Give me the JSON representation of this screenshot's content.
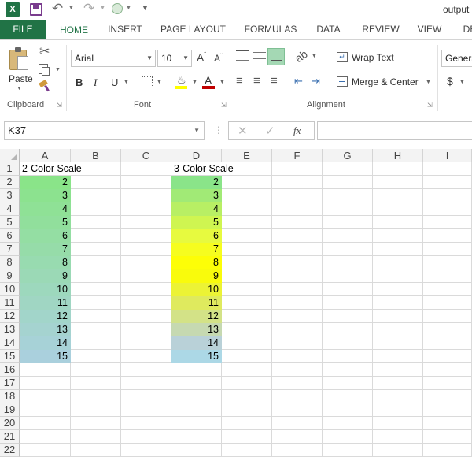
{
  "window": {
    "title": "output"
  },
  "qat": {
    "excel_icon": "excel-icon",
    "save_icon": "save-icon",
    "undo_icon": "undo-icon",
    "redo_icon": "redo-icon",
    "touch_icon": "touch-mode-icon",
    "customize_icon": "customize-icon"
  },
  "tabs": [
    {
      "label": "FILE"
    },
    {
      "label": "HOME"
    },
    {
      "label": "INSERT"
    },
    {
      "label": "PAGE LAYOUT"
    },
    {
      "label": "FORMULAS"
    },
    {
      "label": "DATA"
    },
    {
      "label": "REVIEW"
    },
    {
      "label": "VIEW"
    },
    {
      "label": "DE"
    }
  ],
  "ribbon": {
    "clipboard": {
      "label": "Clipboard",
      "paste": "Paste"
    },
    "font": {
      "label": "Font",
      "name": "Arial",
      "size": "10",
      "bold": "B",
      "italic": "I",
      "underline": "U"
    },
    "alignment": {
      "label": "Alignment",
      "wrap": "Wrap Text",
      "merge": "Merge & Center"
    },
    "number": {
      "format": "Genera",
      "currency": "$"
    }
  },
  "formula_bar": {
    "name_box": "K37",
    "fx": "fx",
    "value": ""
  },
  "columns": [
    "A",
    "B",
    "C",
    "D",
    "E",
    "F",
    "G",
    "H",
    "I"
  ],
  "rows": [
    "1",
    "2",
    "3",
    "4",
    "5",
    "6",
    "7",
    "8",
    "9",
    "10",
    "11",
    "12",
    "13",
    "14",
    "15",
    "16",
    "17",
    "18",
    "19",
    "20",
    "21",
    "22"
  ],
  "cells": {
    "A1": "2-Color Scale",
    "D1": "3-Color Scale",
    "A_values": [
      "2",
      "3",
      "4",
      "5",
      "6",
      "7",
      "8",
      "9",
      "10",
      "11",
      "12",
      "13",
      "14",
      "15"
    ],
    "D_values": [
      "2",
      "3",
      "4",
      "5",
      "6",
      "7",
      "8",
      "9",
      "10",
      "11",
      "12",
      "13",
      "14",
      "15"
    ]
  },
  "colors": {
    "excel_green": "#217346",
    "scaleA": [
      "#8ae489",
      "#8ce28f",
      "#8fe196",
      "#91df9c",
      "#94dea3",
      "#96dca9",
      "#98dbb0",
      "#9bd9b6",
      "#9dd8bd",
      "#a0d6c3",
      "#a2d5ca",
      "#a5d3d0",
      "#a7d2d7",
      "#aad0dd"
    ],
    "scaleD": [
      "#8ae489",
      "#a1ea76",
      "#b8ef64",
      "#cff551",
      "#e7fa3f",
      "#f6fd1f",
      "#fdfe07",
      "#f9fb0c",
      "#ecf335",
      "#dfea5e",
      "#d3e287",
      "#c6d9b1",
      "#b9d1d8",
      "#acd8e6"
    ]
  }
}
